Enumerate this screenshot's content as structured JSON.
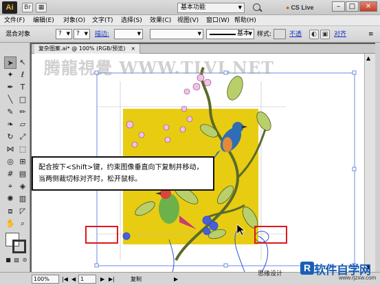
{
  "titlebar": {
    "logo": "Ai",
    "workspace": "基本功能",
    "cs_live": "CS Live",
    "minimize": "–",
    "maximize": "□",
    "close": "✕"
  },
  "menu": [
    "文件(F)",
    "编辑(E)",
    "对象(O)",
    "文字(T)",
    "选择(S)",
    "效果(C)",
    "视图(V)",
    "窗口(W)",
    "帮助(H)"
  ],
  "controlbar": {
    "mode": "混合对象",
    "fill": "?",
    "stroke": "?",
    "stroke_label": "描边:",
    "basic": "基本",
    "style_label": "样式:",
    "opacity_link": "不透",
    "align_link": "对齐"
  },
  "document": {
    "tab_title": "复杂图案.ai* @ 100% (RGB/预览)",
    "tab_close": "×"
  },
  "watermark": "腾龍視覺 WWW.TLVI.NET",
  "callout": "配合按下<Shift>键，约束图像垂直向下复制并移动，当两侧裁切标对齐时，松开鼠标。",
  "statusbar": {
    "zoom": "100%",
    "page": "1",
    "action": "复制"
  },
  "branding": {
    "logo_letter": "R",
    "site": "软件自学网",
    "url": "www.rjzxw.com",
    "sign": "思缘设计"
  },
  "colors": {
    "artboard_yellow": "#e8cc12",
    "highlight_red": "#e0161b",
    "selection_blue": "#4a6fd8"
  }
}
